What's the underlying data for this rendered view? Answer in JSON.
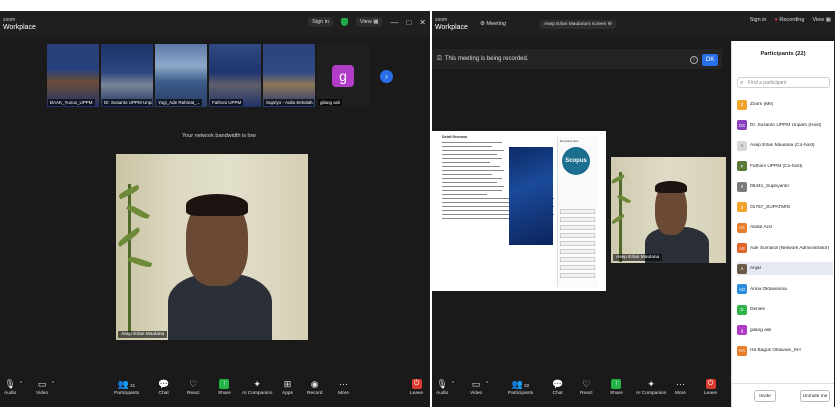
{
  "left": {
    "app": {
      "brand_top": "zoom",
      "brand_bottom": "Workplace"
    },
    "titlebar": {
      "signin": "Sign in",
      "view": "View",
      "minimize": "—",
      "restore": "□",
      "close": "✕"
    },
    "gallery": [
      {
        "label": "BAAK_Yunus_UPPM"
      },
      {
        "label": "Dr. Susanto UPPM Unpam"
      },
      {
        "label": "Yogi_Ade Rahmat_..."
      },
      {
        "label": "Fathoni UPPM"
      },
      {
        "label": "Supriyo - Aulia Sekolah..."
      },
      {
        "label": "gilang asli",
        "initial": "g"
      }
    ],
    "network_message": "Your network bandwidth is low",
    "video_label": "Asep Erlan Maulana",
    "toolbar": [
      {
        "label": "Audio",
        "icon": "microphone-icon"
      },
      {
        "label": "Video",
        "icon": "camera-icon"
      },
      {
        "label": "Participants",
        "icon": "participants-icon",
        "count": "21"
      },
      {
        "label": "Chat",
        "icon": "chat-icon"
      },
      {
        "label": "React",
        "icon": "heart-icon"
      },
      {
        "label": "Share",
        "icon": "share-icon"
      },
      {
        "label": "AI Companion",
        "icon": "sparkle-icon"
      },
      {
        "label": "Apps",
        "icon": "apps-icon"
      },
      {
        "label": "Record",
        "icon": "record-icon"
      },
      {
        "label": "More",
        "icon": "more-icon"
      },
      {
        "label": "Leave",
        "icon": "leave-icon"
      }
    ]
  },
  "right": {
    "app": {
      "brand_top": "zoom",
      "brand_bottom": "Workplace"
    },
    "titlebar": {
      "meeting": "Meeting",
      "screen_share": "Asep Erlan Maulana's screen",
      "signin": "Sign in",
      "recording": "Recording",
      "view": "View"
    },
    "recording_notice": "This meeting is being recorded.",
    "ok": "OK",
    "shared_doc": {
      "title": "Detail Rencana",
      "badge": "Scopus",
      "right_title": "Rencana Aksi"
    },
    "video_label": "Asep Erlan Maulana",
    "toolbar": [
      {
        "label": "Audio",
        "icon": "microphone-icon"
      },
      {
        "label": "Video",
        "icon": "camera-icon"
      },
      {
        "label": "Participants",
        "icon": "participants-icon",
        "count": "22"
      },
      {
        "label": "Chat",
        "icon": "chat-icon"
      },
      {
        "label": "React",
        "icon": "heart-icon"
      },
      {
        "label": "Share",
        "icon": "share-icon"
      },
      {
        "label": "AI Companion",
        "icon": "sparkle-icon"
      },
      {
        "label": "More",
        "icon": "more-icon"
      },
      {
        "label": "Leave",
        "icon": "leave-icon"
      }
    ],
    "participants_panel": {
      "title": "Participants (22)",
      "search_placeholder": "Find a participant",
      "participants": [
        {
          "initials": "Z",
          "name": "Zoom (Me)",
          "color": "#f2a32c"
        },
        {
          "initials": "DS",
          "name": "Dr. Susanto UPPM Unpam (Host)",
          "color": "#8b3fbf"
        },
        {
          "initials": "A",
          "name": "Asep Erlan Maulana (Co-host)",
          "color": "#d8d8d8"
        },
        {
          "initials": "F",
          "name": "Fathoni UPPM (Co-host)",
          "color": "#5a7a3a"
        },
        {
          "initials": "0",
          "name": "06441_Supriyanto",
          "color": "#7a7a7a"
        },
        {
          "initials": "0",
          "name": "01767_SUPATMIN",
          "color": "#f2a32c"
        },
        {
          "initials": "AA",
          "name": "Abdul Aziz",
          "color": "#e87e2a"
        },
        {
          "initials": "AS",
          "name": "Ade Sumardi (Network Administrator)",
          "color": "#e0632a"
        },
        {
          "initials": "A",
          "name": "Anjar",
          "color": "#6a5a4a"
        },
        {
          "initials": "AO",
          "name": "Anna Oktavianna",
          "color": "#2a8de0"
        },
        {
          "initials": "D",
          "name": "Denies",
          "color": "#2fb54a"
        },
        {
          "initials": "g",
          "name": "gilang asli",
          "color": "#b03cc8"
        },
        {
          "initials": "HA",
          "name": "Hd Bagus Oktavian_KH",
          "color": "#e87e2a"
        }
      ],
      "invite": "Invite",
      "unmute_me": "Unmute me"
    }
  }
}
